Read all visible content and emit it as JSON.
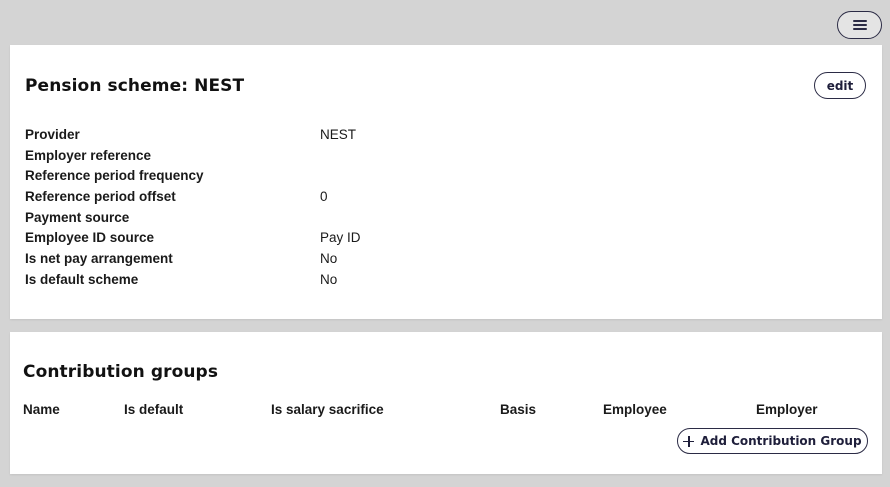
{
  "header": {
    "menu_icon": "hamburger-menu-icon"
  },
  "scheme": {
    "title": "Pension scheme: NEST",
    "edit_label": "edit",
    "details": [
      {
        "label": "Provider",
        "value": "NEST"
      },
      {
        "label": "Employer reference",
        "value": ""
      },
      {
        "label": "Reference period frequency",
        "value": ""
      },
      {
        "label": "Reference period offset",
        "value": "0"
      },
      {
        "label": "Payment source",
        "value": ""
      },
      {
        "label": "Employee ID source",
        "value": "Pay ID"
      },
      {
        "label": "Is net pay arrangement",
        "value": "No"
      },
      {
        "label": "Is default scheme",
        "value": "No"
      }
    ]
  },
  "groups": {
    "title": "Contribution groups",
    "columns": [
      "Name",
      "Is default",
      "Is salary sacrifice",
      "Basis",
      "Employee",
      "Employer"
    ],
    "add_label": "Add Contribution Group",
    "add_icon": "plus-icon"
  }
}
